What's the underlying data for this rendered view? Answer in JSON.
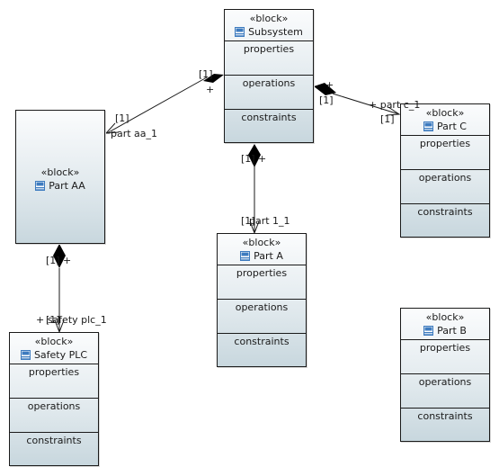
{
  "diagram": {
    "type": "SysML Block Definition Diagram",
    "stereotype": "«block»",
    "compartments": [
      "properties",
      "operations",
      "constraints"
    ],
    "blocks": [
      {
        "id": "subsystem",
        "name": "Subsystem",
        "collapsed": false
      },
      {
        "id": "part_aa",
        "name": "Part AA",
        "collapsed": true
      },
      {
        "id": "part_c",
        "name": "Part C",
        "collapsed": false
      },
      {
        "id": "part_a",
        "name": "Part A",
        "collapsed": false
      },
      {
        "id": "safety_plc",
        "name": "Safety PLC",
        "collapsed": false
      },
      {
        "id": "part_b",
        "name": "Part B",
        "collapsed": false
      }
    ],
    "associations": [
      {
        "kind": "composition",
        "from": "Subsystem",
        "to": "Part AA",
        "source_mult": "[1]",
        "target_mult": "[1]",
        "role": "+ part aa_1"
      },
      {
        "kind": "composition",
        "from": "Subsystem",
        "to": "Part C",
        "source_mult": "[1]",
        "target_mult": "[1]",
        "role": "+ part c_1"
      },
      {
        "kind": "composition",
        "from": "Subsystem",
        "to": "Part A",
        "source_mult": "[1]",
        "target_mult": "[1]",
        "role": "+ part 1_1"
      },
      {
        "kind": "composition",
        "from": "Part AA",
        "to": "Safety PLC",
        "source_mult": "[1]",
        "target_mult": "[1]",
        "role": "+ safety plc_1"
      }
    ],
    "colors": {
      "line": "#1a1a1a",
      "block_top": "#fbfcfd",
      "block_bottom": "#c8d7de",
      "icon": "#3d7bbf"
    }
  },
  "labels": {
    "plus": "+",
    "mult": "[1]",
    "aa_role": "part aa_1",
    "c_role": "+ part c_1",
    "a_role": "part 1_1",
    "plc_role": "+ safety plc_1"
  }
}
